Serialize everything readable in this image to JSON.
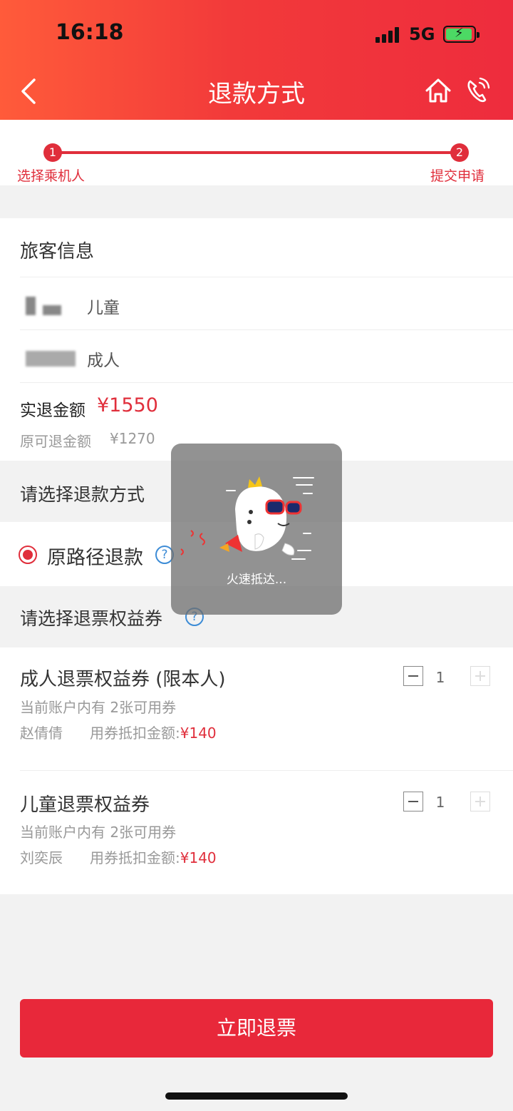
{
  "status_bar": {
    "time": "16:18",
    "network": "5G"
  },
  "header": {
    "title": "退款方式"
  },
  "steps": [
    {
      "number": "1",
      "label": "选择乘机人"
    },
    {
      "number": "2",
      "label": "提交申请"
    }
  ],
  "passenger_info": {
    "title": "旅客信息",
    "passengers": [
      {
        "type": "儿童"
      },
      {
        "type": "成人"
      }
    ]
  },
  "refund_amount": {
    "label": "实退金额",
    "value": "¥1550",
    "original_label": "原可退金额",
    "original_value": "¥1270"
  },
  "refund_method": {
    "title": "请选择退款方式",
    "option": "原路径退款",
    "help": "?"
  },
  "coupons": {
    "title": "请选择退票权益券",
    "help": "?",
    "items": [
      {
        "name": "成人退票权益券 (限本人)",
        "availability": "当前账户内有 2张可用券",
        "person": "赵倩倩",
        "deduct_label": "用券抵扣金额:",
        "deduct_value": "¥140",
        "quantity": "1"
      },
      {
        "name": "儿童退票权益券",
        "availability": "当前账户内有 2张可用券",
        "person": "刘奕辰",
        "deduct_label": "用券抵扣金额:",
        "deduct_value": "¥140",
        "quantity": "1"
      }
    ]
  },
  "submit_label": "立即退票",
  "loading": {
    "text": "火速抵达..."
  },
  "colors": {
    "brand_red": "#e02e3b",
    "header_gradient_start": "#ff5b3a",
    "header_gradient_end": "#ee2c3d",
    "link_blue": "#3d8cd6"
  }
}
